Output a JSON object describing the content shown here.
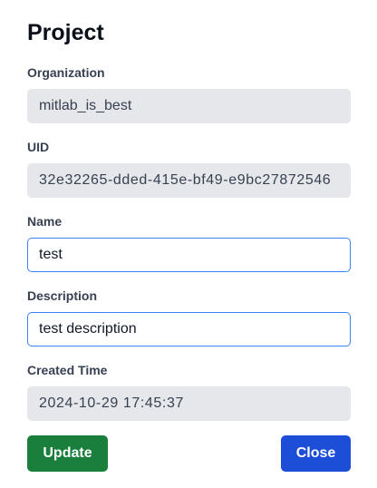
{
  "dialog": {
    "title": "Project"
  },
  "fields": {
    "organization": {
      "label": "Organization",
      "value": "mitlab_is_best"
    },
    "uid": {
      "label": "UID",
      "value": "32e32265-dded-415e-bf49-e9bc27872546"
    },
    "name": {
      "label": "Name",
      "value": "test"
    },
    "description": {
      "label": "Description",
      "value": "test description"
    },
    "created_time": {
      "label": "Created Time",
      "value": "2024-10-29 17:45:37"
    }
  },
  "actions": {
    "update_label": "Update",
    "close_label": "Close"
  },
  "colors": {
    "update_button": "#1a7f3d",
    "close_button": "#1d4ed8",
    "readonly_field": "#e5e7eb",
    "focus_border": "#3b82f6"
  }
}
